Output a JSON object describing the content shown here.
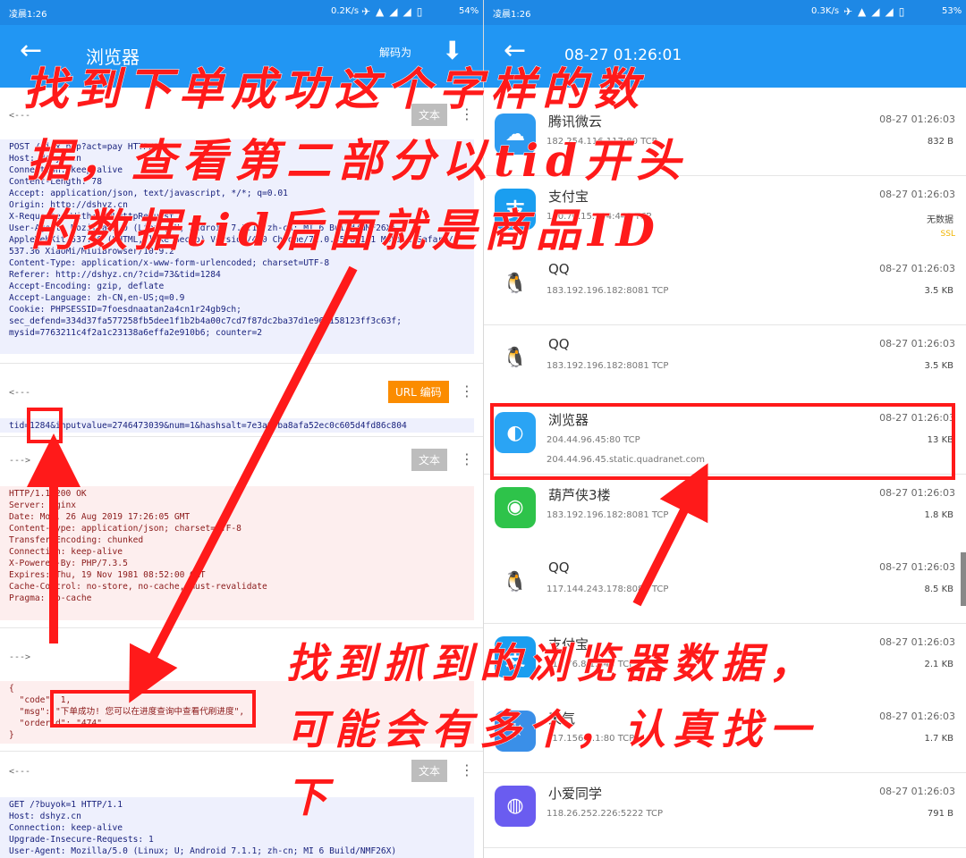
{
  "left": {
    "status": {
      "time": "凌晨1:26",
      "speed": "0.2K/s",
      "battery": "54%"
    },
    "appbar": {
      "back_icon": "arrow-left-icon",
      "title": "浏览器",
      "decode_label": "解码为",
      "download_icon": "download-icon"
    },
    "sections": [
      {
        "arrow": "<---",
        "chip": "文本"
      },
      {
        "arrow": "<---",
        "chip": "URL 编码"
      },
      {
        "arrow": "--->",
        "chip": "文本"
      },
      {
        "arrow": "--->",
        "chip": ""
      },
      {
        "arrow": "<---",
        "chip": "文本"
      }
    ],
    "request_lines": [
      "POST /ajax.php?act=pay HTTP/1.1",
      "Host: dshyz.cn",
      "Connection: keep-alive",
      "Content-Length: 78",
      "Accept: application/json, text/javascript, */*; q=0.01",
      "Origin: http://dshyz.cn",
      "X-Requested-With: XMLHttpRequest",
      "User-Agent: Mozilla/5.0 (Linux; U; Android 7.1.1; zh-cn; MI 6 Build/NMF26X)",
      "AppleWebKit/537.36 (KHTML, like Gecko) Version/4.0 Chrome/71.0.3578.141 Mobile Safari/",
      "537.36 XiaoMi/MiuiBrowser/10.9.2",
      "Content-Type: application/x-www-form-urlencoded; charset=UTF-8",
      "Referer: http://dshyz.cn/?cid=73&tid=1284",
      "Accept-Encoding: gzip, deflate",
      "Accept-Language: zh-CN,en-US;q=0.9",
      "Cookie: PHPSESSID=7foesdnaatan2a4cn1r24gb9ch;",
      "sec_defend=334d37fa577258fb5dee1f1b2b4a00c7cd7f87dc2ba37d1e961158123ff3c63f;",
      "mysid=7763211c4f2a1c23138a6effa2e910b6; counter=2"
    ],
    "body_line": "tid=1284&inputvalue=2746473039&num=1&hashsalt=7e3a0fba8afa52ec0c605d4fd86c804",
    "response_lines": [
      "HTTP/1.1 200 OK",
      "Server: nginx",
      "Date: Mon, 26 Aug 2019 17:26:05 GMT",
      "Content-Type: application/json; charset=UTF-8",
      "Transfer-Encoding: chunked",
      "Connection: keep-alive",
      "X-Powered-By: PHP/7.3.5",
      "Expires: Thu, 19 Nov 1981 08:52:00 GMT",
      "Cache-Control: no-store, no-cache, must-revalidate",
      "Pragma: no-cache"
    ],
    "json_lines": [
      "{",
      "  \"code\": 1,",
      "  \"msg\": \"下单成功! 您可以在进度查询中查看代刷进度\",",
      "  \"orderid\": \"474\"",
      "}"
    ],
    "get_lines": [
      "GET /?buyok=1 HTTP/1.1",
      "Host: dshyz.cn",
      "Connection: keep-alive",
      "Upgrade-Insecure-Requests: 1",
      "User-Agent: Mozilla/5.0 (Linux; U; Android 7.1.1; zh-cn; MI 6 Build/NMF26X)"
    ]
  },
  "right": {
    "status": {
      "time": "凌晨1:26",
      "speed": "0.3K/s",
      "battery": "53%"
    },
    "appbar": {
      "back_icon": "arrow-left-icon",
      "title": "08-27 01:26:01"
    },
    "rows": [
      {
        "name": "腾讯微云",
        "icon": "weiyun-icon",
        "color": "#2e9bf0",
        "addr": "182.254.116.117:80 TCP",
        "time": "08-27 01:26:03",
        "size": "832 B",
        "ssl": ""
      },
      {
        "name": "支付宝",
        "icon": "alipay-icon",
        "color": "#1a9ef0",
        "addr": "110.76.15.204:443 TCP",
        "time": "08-27 01:26:03",
        "size": "无数据",
        "ssl": "SSL"
      },
      {
        "name": "QQ",
        "icon": "qq-penguin-icon",
        "color": "#ffffff",
        "addr": "183.192.196.182:8081 TCP",
        "time": "08-27 01:26:03",
        "size": "3.5 KB",
        "ssl": ""
      },
      {
        "name": "QQ",
        "icon": "qq-penguin-icon",
        "color": "#ffffff",
        "addr": "183.192.196.182:8081 TCP",
        "time": "08-27 01:26:03",
        "size": "3.5 KB",
        "ssl": ""
      },
      {
        "name": "浏览器",
        "icon": "browser-icon",
        "color": "#2aa4f4",
        "addr": "204.44.96.45:80 TCP",
        "host": "204.44.96.45.static.quadranet.com",
        "time": "08-27 01:26:03",
        "size": "13 KB",
        "ssl": ""
      },
      {
        "name": "葫芦侠3楼",
        "icon": "huluxia-icon",
        "color": "#2ec34a",
        "addr": "183.192.196.182:8081 TCP",
        "time": "08-27 01:26:03",
        "size": "1.8 KB",
        "ssl": ""
      },
      {
        "name": "QQ",
        "icon": "qq-penguin-icon",
        "color": "#ffffff",
        "addr": "117.144.243.178:8080 TCP",
        "time": "08-27 01:26:03",
        "size": "8.5 KB",
        "ssl": ""
      },
      {
        "name": "支付宝",
        "icon": "alipay-icon",
        "color": "#1a9ef0",
        "addr": "110.76.8.1:443 TCP",
        "time": "08-27 01:26:03",
        "size": "2.1 KB",
        "ssl": ""
      },
      {
        "name": "天气",
        "icon": "weather-icon",
        "color": "#3a8fe8",
        "addr": "117.156.8.1:80 TCP",
        "time": "08-27 01:26:03",
        "size": "1.7 KB",
        "ssl": ""
      },
      {
        "name": "小爱同学",
        "icon": "xiaoai-icon",
        "color": "#6a5cf0",
        "addr": "118.26.252.226:5222 TCP",
        "time": "08-27 01:26:03",
        "size": "791 B",
        "ssl": ""
      }
    ]
  },
  "overlay": {
    "line1": "找到下单成功这个字样的数",
    "line2": "据，查看第二部分以tid开头",
    "line3": "的数据tid后面就是商品ID",
    "line4": "找到抓到的浏览器数据，",
    "line5": "可能会有多个，认真找一",
    "line6": "下"
  },
  "accent_red": "#ff1a1a",
  "accent_blue": "#2196f3"
}
